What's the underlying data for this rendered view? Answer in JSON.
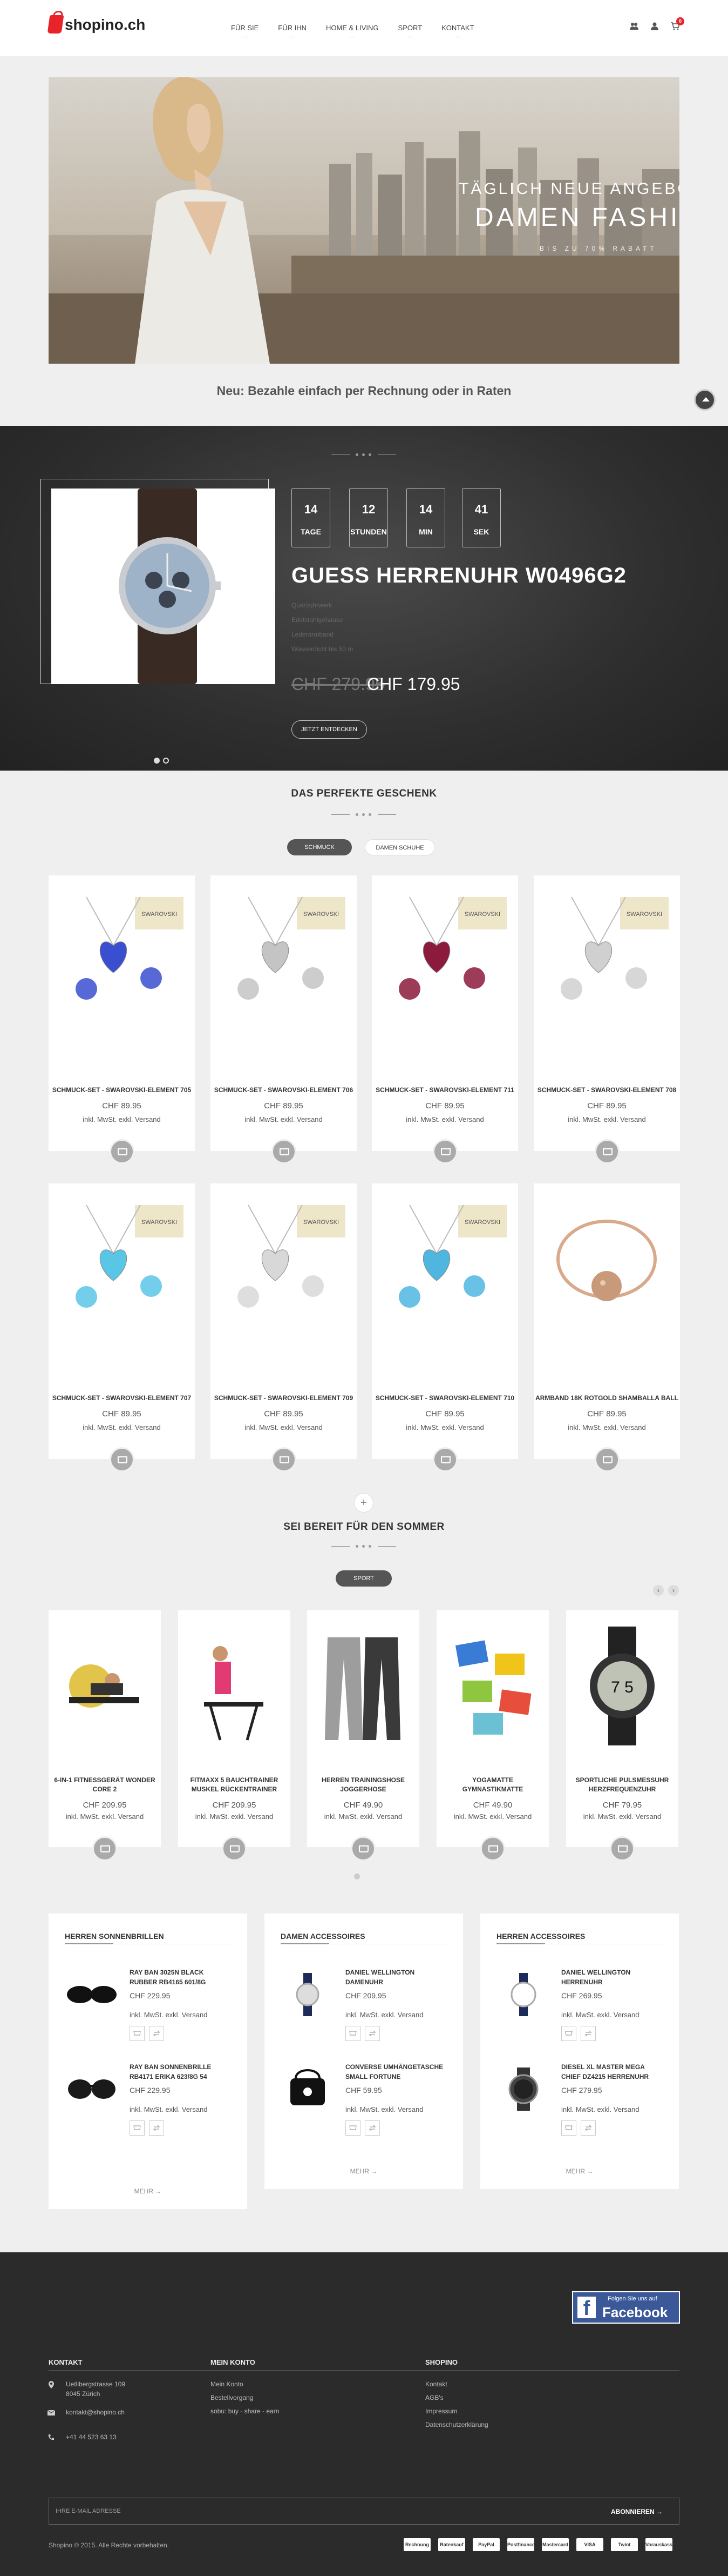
{
  "brand": {
    "name": "shopino.ch",
    "accent": "#e8232a"
  },
  "nav": [
    "Für Sie",
    "Für Ihn",
    "Home & Living",
    "Sport",
    "Kontakt"
  ],
  "header_icons": [
    "users-icon",
    "user-icon",
    "cart-icon"
  ],
  "cart_count": "0",
  "hero": {
    "line1": "Täglich neue Angebote",
    "line2": "Damen Fashion",
    "line3": "bis zu 70% Rabatt"
  },
  "tagline": "Neu: Bezahle einfach per Rechnung oder in Raten",
  "deal": {
    "countdown": [
      {
        "n": "14",
        "u": "Tage"
      },
      {
        "n": "12",
        "u": "Stunden"
      },
      {
        "n": "14",
        "u": "Min"
      },
      {
        "n": "41",
        "u": "Sek"
      }
    ],
    "title": "GUESS HERRENUHR W0496G2",
    "features": [
      "Quarzuhrwerk",
      "Edelstahlgehäuse",
      "Lederarmband",
      "Wasserdicht bis 50 m"
    ],
    "old_price": "CHF 279.95",
    "new_price": "CHF 179.95",
    "button": "Jetzt entdecken"
  },
  "gift": {
    "title": "Das perfekte Geschenk",
    "tabs": [
      "Schmuck",
      "Damen Schuhe"
    ],
    "products": [
      {
        "name": "Schmuck-Set - Swarovski-Element 705",
        "price": "CHF 89.95"
      },
      {
        "name": "Schmuck-Set - Swarovski-Element 706",
        "price": "CHF 89.95"
      },
      {
        "name": "Schmuck-Set - Swarovski-Element 711",
        "price": "CHF 89.95"
      },
      {
        "name": "Schmuck-Set - Swarovski-Element 708",
        "price": "CHF 89.95"
      },
      {
        "name": "Schmuck-Set - Swarovski-Element 707",
        "price": "CHF 89.95"
      },
      {
        "name": "Schmuck-Set - Swarovski-Element 709",
        "price": "CHF 89.95"
      },
      {
        "name": "Schmuck-Set - Swarovski-Element 710",
        "price": "CHF 89.95"
      },
      {
        "name": "Armband 18K Rotgold Shamballa Ball",
        "price": "CHF 89.95"
      }
    ],
    "shipping": "inkl. MwSt. exkl. Versand"
  },
  "summer": {
    "title": "Sei bereit für den Sommer",
    "tab": "Sport",
    "products": [
      {
        "name": "6-in-1 Fitnessgerät Wonder Core 2",
        "price": "CHF 209.95"
      },
      {
        "name": "Fitmaxx 5 Bauchtrainer Muskel Rückentrainer",
        "price": "CHF 209.95"
      },
      {
        "name": "Herren Trainingshose Joggerhose",
        "price": "CHF 49.90"
      },
      {
        "name": "Yogamatte Gymnastikmatte",
        "price": "CHF 49.90"
      },
      {
        "name": "Sportliche Pulsmessuhr Herzfrequenzuhr",
        "price": "CHF 79.95"
      }
    ],
    "shipping": "inkl. MwSt. exkl. Versand"
  },
  "boxes": [
    {
      "title": "Herren Sonnenbrillen",
      "items": [
        {
          "name": "Ray Ban 3025N Black Rubber RB4165 601/8G",
          "price": "CHF 229.95"
        },
        {
          "name": "Ray Ban Sonnenbrille RB4171 Erika 623/8G 54",
          "price": "CHF 229.95"
        }
      ],
      "more": "Mehr"
    },
    {
      "title": "Damen Accessoires",
      "items": [
        {
          "name": "Daniel Wellington Damenuhr",
          "price": "CHF 209.95"
        },
        {
          "name": "Converse Umhängetasche small Fortune",
          "price": "CHF 59.95"
        }
      ],
      "more": "Mehr"
    },
    {
      "title": "Herren Accessoires",
      "items": [
        {
          "name": "Daniel Wellington Herrenuhr",
          "price": "CHF 269.95"
        },
        {
          "name": "Diesel XL Master Mega Chief DZ4215 Herrenuhr",
          "price": "CHF 279.95"
        }
      ],
      "more": "Mehr"
    }
  ],
  "box_shipping": "inkl. MwSt. exkl. Versand",
  "footer": {
    "facebook": {
      "small": "Folgen Sie uns auf",
      "name": "Facebook"
    },
    "kontakt": {
      "title": "Kontakt",
      "address1": "Uetlibergstrasse 109",
      "address2": "8045 Zürich",
      "email": "kontakt@shopino.ch",
      "phone": "+41 44 523 63 13"
    },
    "konto": {
      "title": "Mein Konto",
      "links": [
        "Mein Konto",
        "Bestellvorgang",
        "sobu: buy - share - earn"
      ]
    },
    "shopino": {
      "title": "Shopino",
      "links": [
        "Kontakt",
        "AGB's",
        "Impressum",
        "Datenschutzerklärung"
      ]
    },
    "newsletter_placeholder": "Ihre E-Mail Adresse",
    "newsletter_button": "Abonnieren",
    "copyright": "Shopino © 2015. Alle Rechte vorbehalten.",
    "payments": [
      "Rechnung",
      "Ratenkauf",
      "PayPal",
      "Postfinance",
      "Mastercard",
      "VISA",
      "Twint",
      "Vorauskasse"
    ]
  }
}
